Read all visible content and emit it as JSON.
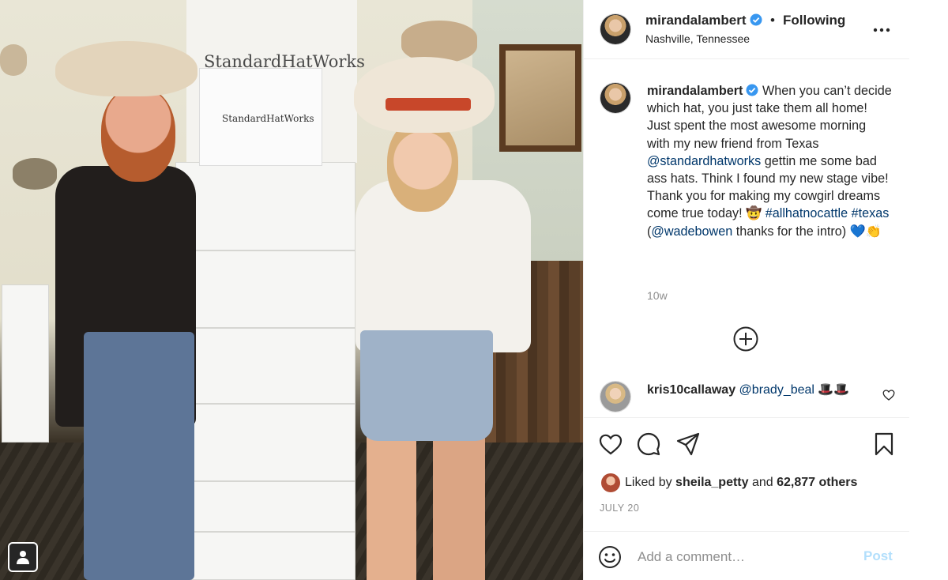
{
  "post": {
    "author": "mirandalambert",
    "follow_status": "Following",
    "separator": "•",
    "location": "Nashville, Tennessee",
    "photo_bag_text": "StandardHatWorks",
    "photo_sign_text": "StandardHatWorks"
  },
  "caption": {
    "username": "mirandalambert",
    "text_1": "When you can’t decide which hat, you just take them all home! Just spent the most awesome morning with my new friend from Texas ",
    "mention_1": "@standardhatworks",
    "text_2": " gettin me some bad ass hats. Think I found my new stage vibe! Thank you for making my cowgirl dreams come true today! 🤠 ",
    "hashtag_1": "#allhatnocattle",
    "space": " ",
    "hashtag_2": "#texas",
    "text_3": " (",
    "mention_2": "@wadebowen",
    "text_4": " thanks for the intro) 💙👏",
    "age": "10w"
  },
  "comment": {
    "username": "kris10callaway",
    "mention": "@brady_beal",
    "text": " 🎩🎩"
  },
  "likes": {
    "prefix": "Liked by ",
    "user": "sheila_petty",
    "middle": " and ",
    "count": "62,877 others"
  },
  "date": "JULY 20",
  "comment_box": {
    "placeholder": "Add a comment…",
    "post_label": "Post"
  },
  "icons": {
    "verified": "verified-badge-icon",
    "more": "more-options-icon",
    "plus": "load-more-comments-icon",
    "heart": "heart-icon",
    "comment": "comment-icon",
    "share": "share-icon",
    "save": "bookmark-icon",
    "emoji": "emoji-icon",
    "user_tag": "user-tag-icon"
  },
  "colors": {
    "link": "#00376b",
    "verified": "#3897f0",
    "muted": "#8e8e8e",
    "post_disabled": "#b2dffc"
  }
}
